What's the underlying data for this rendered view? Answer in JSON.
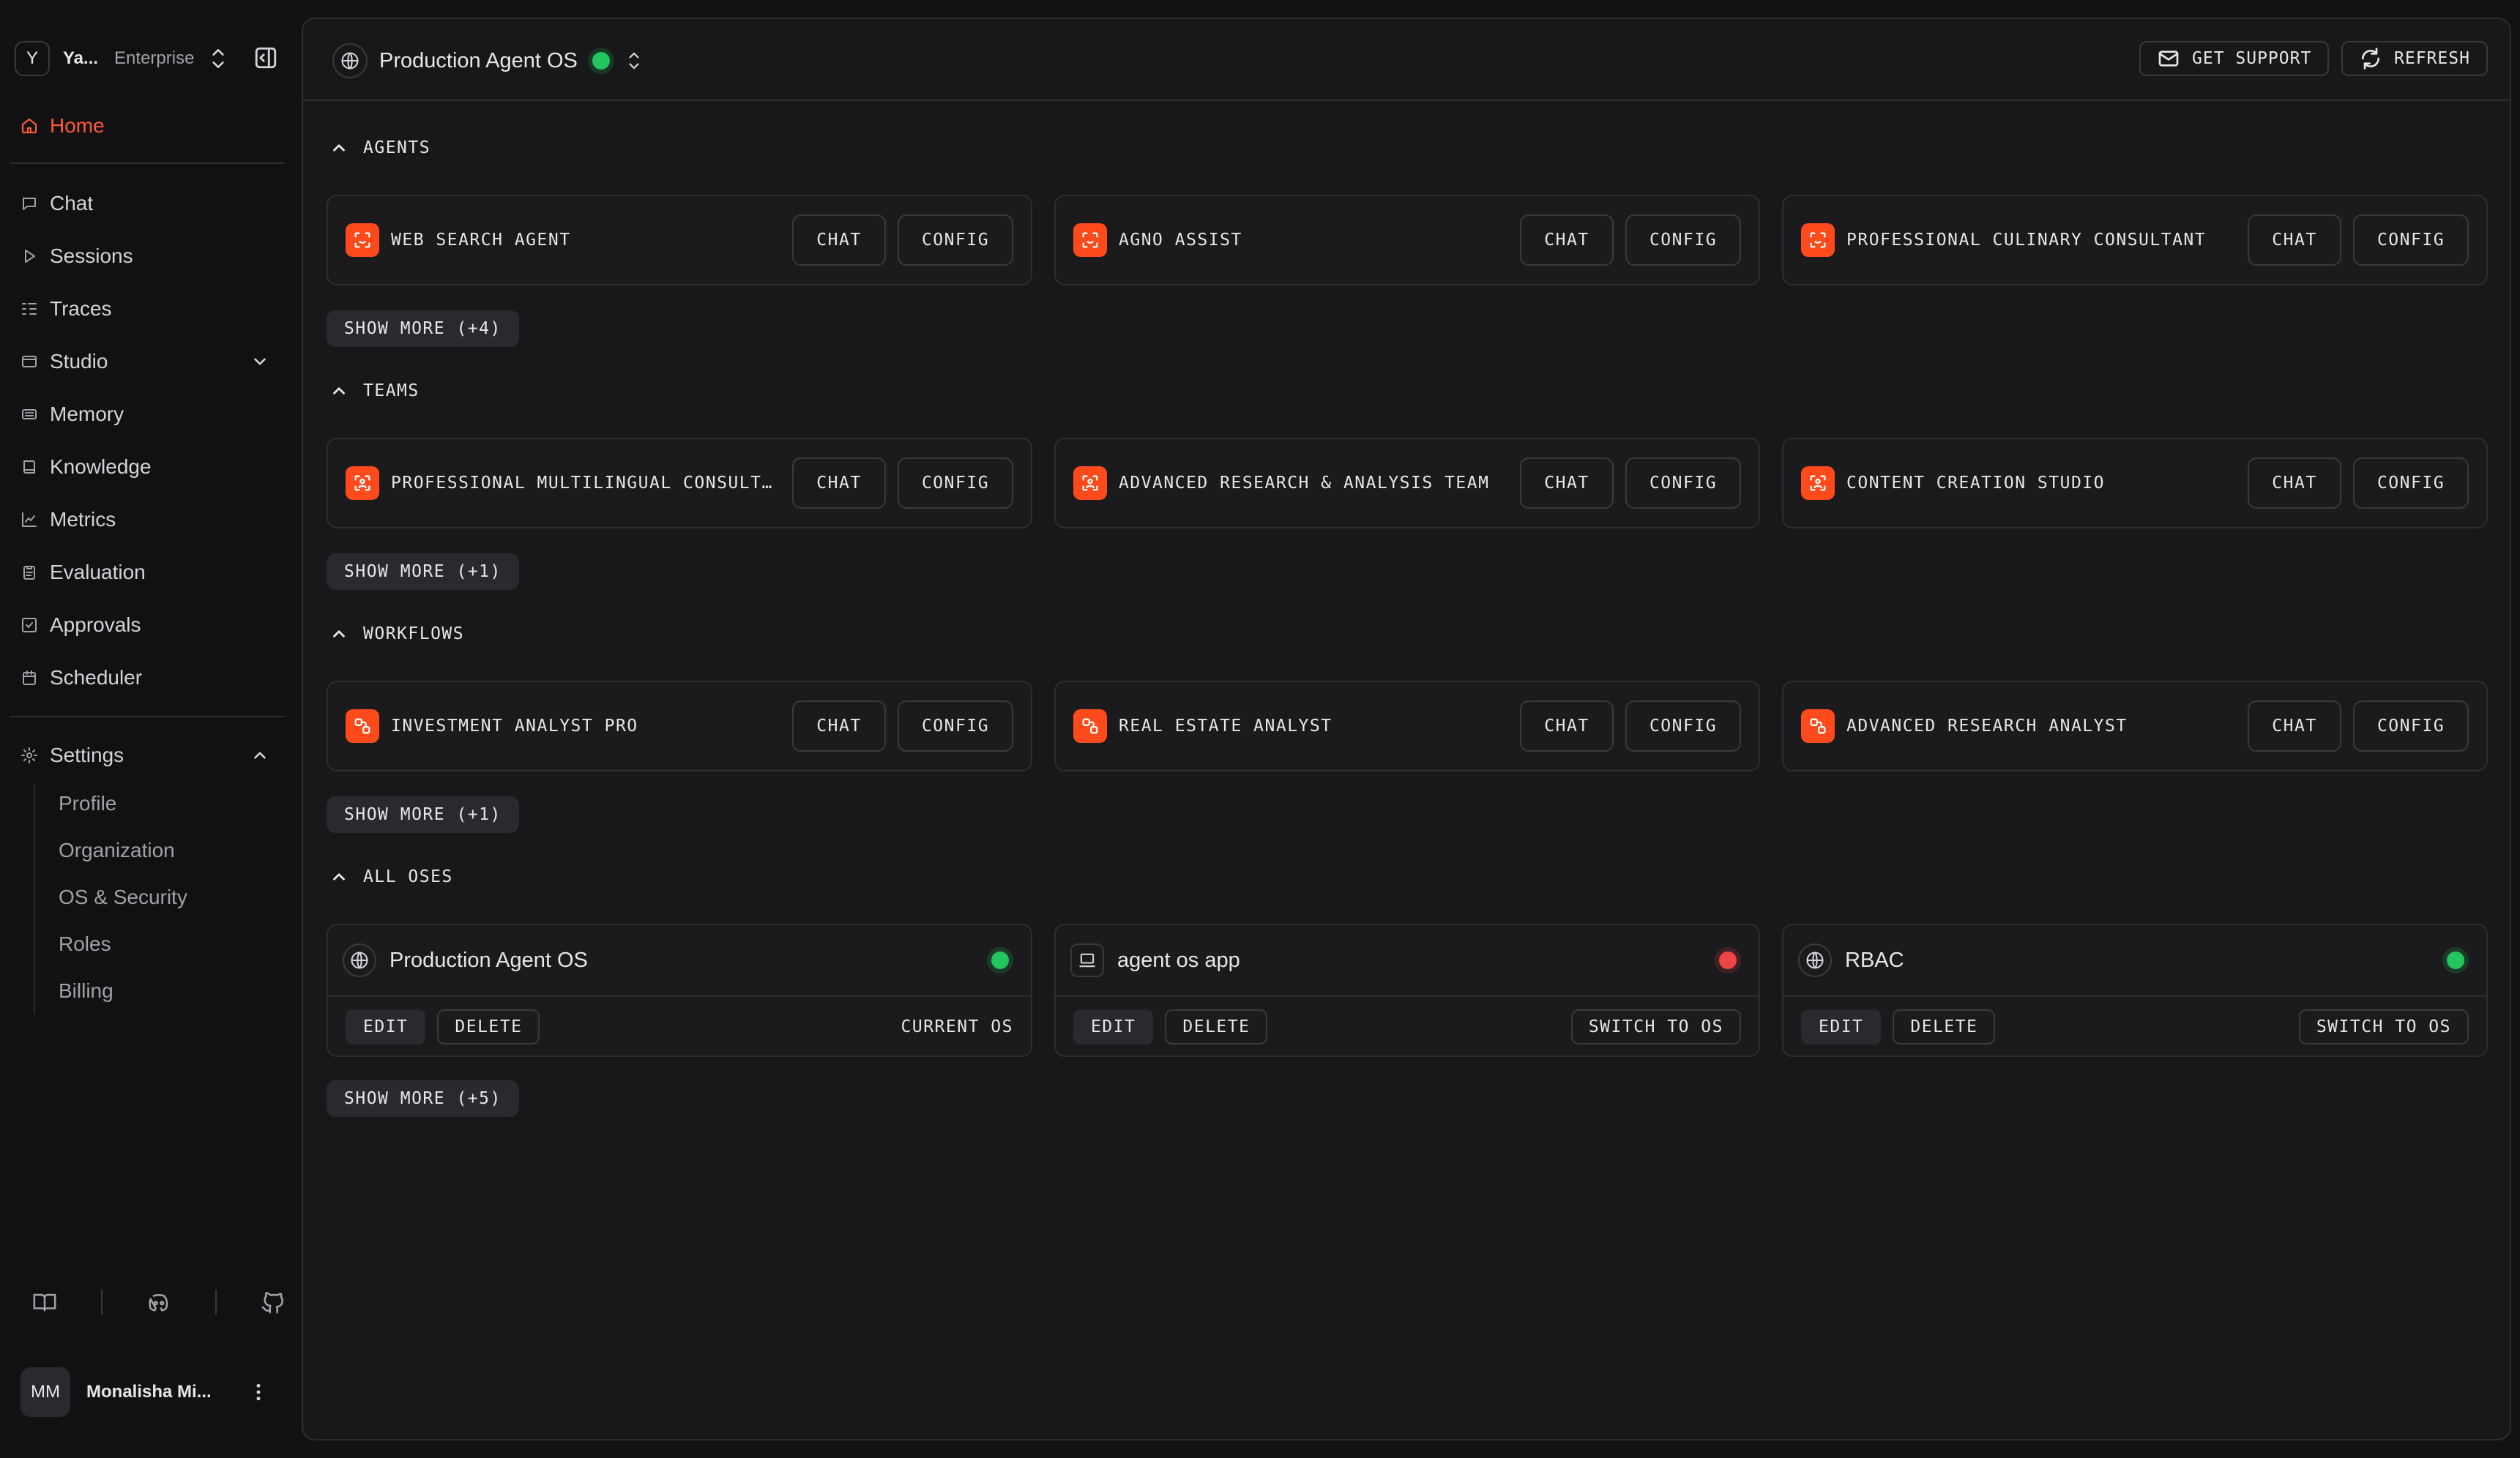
{
  "workspace": {
    "badge": "Y",
    "name": "Ya...",
    "plan": "Enterprise"
  },
  "nav": {
    "home": "Home",
    "items": [
      "Chat",
      "Sessions",
      "Traces",
      "Studio",
      "Memory",
      "Knowledge",
      "Metrics",
      "Evaluation",
      "Approvals",
      "Scheduler"
    ],
    "settings": "Settings",
    "settings_items": [
      "Profile",
      "Organization",
      "OS & Security",
      "Roles",
      "Billing"
    ]
  },
  "user": {
    "initials": "MM",
    "name": "Monalisha Mi..."
  },
  "header": {
    "os_name": "Production Agent OS",
    "get_support": "GET SUPPORT",
    "refresh": "REFRESH"
  },
  "colors": {
    "accent": "#ff4a1c",
    "online": "#22c55e",
    "offline": "#ef4444"
  },
  "sections": {
    "agents": {
      "title": "AGENTS",
      "items": [
        "WEB SEARCH AGENT",
        "AGNO ASSIST",
        "PROFESSIONAL CULINARY CONSULTANT"
      ],
      "show_more": "SHOW MORE (+4)"
    },
    "teams": {
      "title": "TEAMS",
      "items": [
        "PROFESSIONAL MULTILINGUAL CONSULTANT",
        "ADVANCED RESEARCH & ANALYSIS TEAM",
        "CONTENT CREATION STUDIO"
      ],
      "show_more": "SHOW MORE (+1)"
    },
    "workflows": {
      "title": "WORKFLOWS",
      "items": [
        "INVESTMENT ANALYST PRO",
        "REAL ESTATE ANALYST",
        "ADVANCED RESEARCH ANALYST"
      ],
      "show_more": "SHOW MORE (+1)"
    },
    "oses": {
      "title": "ALL OSES",
      "items": [
        {
          "name": "Production Agent OS",
          "status": "online",
          "action": "CURRENT OS"
        },
        {
          "name": "agent os app",
          "status": "offline",
          "action": "SWITCH TO OS"
        },
        {
          "name": "RBAC",
          "status": "online",
          "action": "SWITCH TO OS"
        }
      ],
      "show_more": "SHOW MORE (+5)"
    }
  },
  "buttons": {
    "chat": "CHAT",
    "config": "CONFIG",
    "edit": "EDIT",
    "delete": "DELETE"
  }
}
